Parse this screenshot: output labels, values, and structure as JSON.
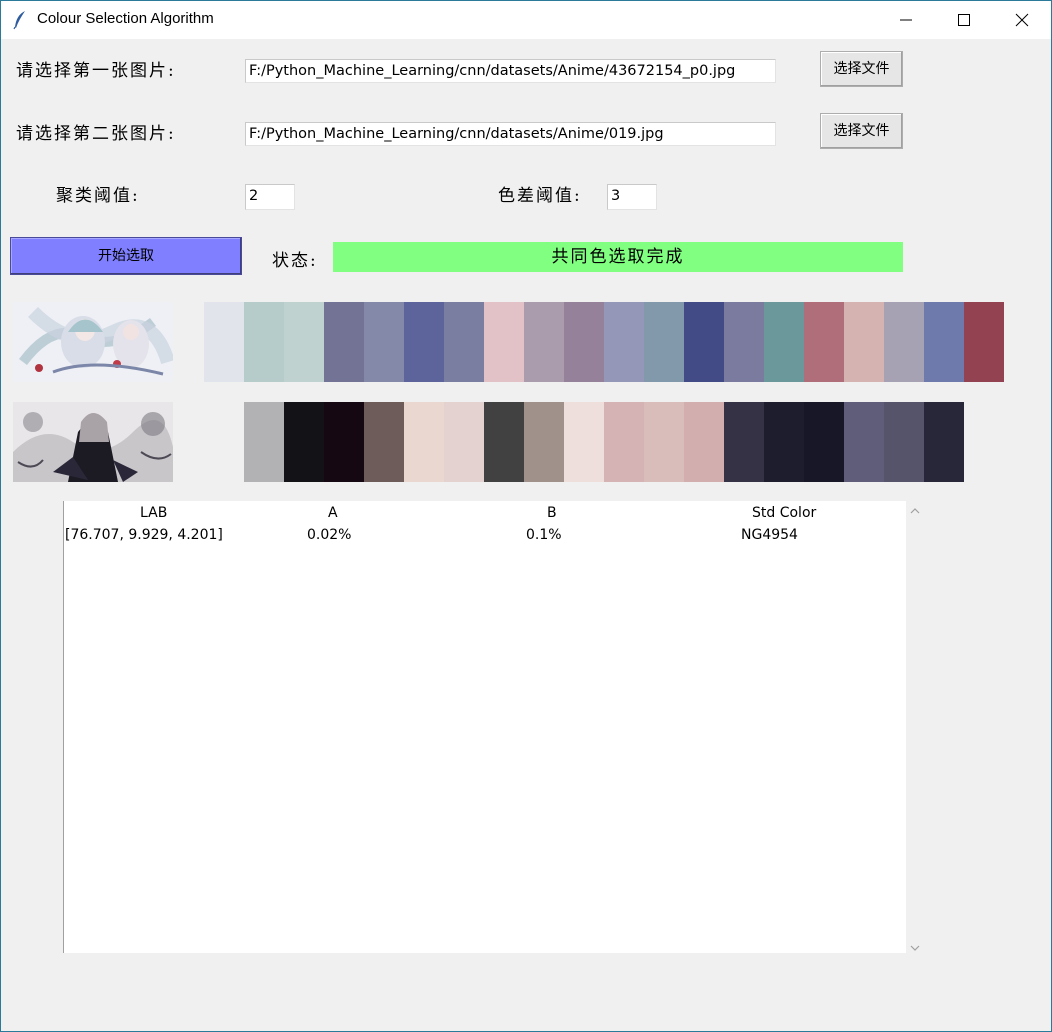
{
  "window": {
    "title": "Colour Selection Algorithm"
  },
  "form": {
    "image1_label": "请选择第一张图片:",
    "image1_path": "F:/Python_Machine_Learning/cnn/datasets/Anime/43672154_p0.jpg",
    "image1_button": "选择文件",
    "image2_label": "请选择第二张图片:",
    "image2_path": "F:/Python_Machine_Learning/cnn/datasets/Anime/019.jpg",
    "image2_button": "选择文件",
    "cluster_label": "聚类阈值:",
    "cluster_value": "2",
    "color_diff_label": "色差阈值:",
    "color_diff_value": "3",
    "start_button": "开始选取",
    "status_label": "状态:",
    "status_text": "共同色选取完成"
  },
  "palettes": {
    "row1": [
      "#e1e4ea",
      "#b6cccb",
      "#c0d2d0",
      "#737495",
      "#8589a9",
      "#5d649b",
      "#7a7ea0",
      "#e2c2c6",
      "#aa9bad",
      "#95829a",
      "#9597b9",
      "#8298ab",
      "#434b87",
      "#7b7b9f",
      "#6a989b",
      "#b06e7a",
      "#d5b3b1",
      "#a6a2b3",
      "#6d7aab",
      "#934251"
    ],
    "row2": [
      "#b2b2b4",
      "#131317",
      "#160812",
      "#6e5c5a",
      "#e9d7d0",
      "#e4d2d0",
      "#414141",
      "#a0918b",
      "#eedfdc",
      "#d5b3b4",
      "#d9bdbb",
      "#d2aeae",
      "#353246",
      "#1d1d2d",
      "#171727",
      "#605d7a",
      "#56546a",
      "#282639"
    ]
  },
  "table": {
    "headers": [
      "LAB",
      "A",
      "B",
      "Std Color"
    ],
    "rows": [
      [
        "[76.707, 9.929, 4.201]",
        "0.02%",
        "0.1%",
        "NG4954"
      ]
    ]
  }
}
